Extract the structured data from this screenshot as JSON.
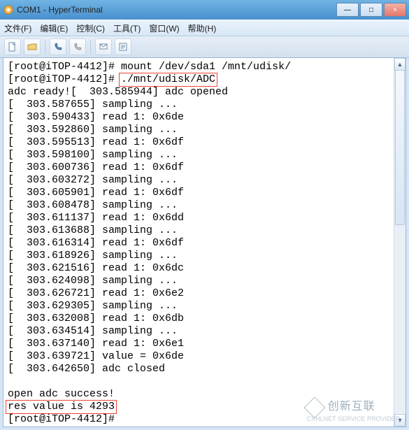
{
  "window": {
    "title": "COM1 - HyperTerminal",
    "buttons": {
      "min": "—",
      "max": "□",
      "close": "×"
    }
  },
  "menu": {
    "file": "文件(F)",
    "edit": "编辑(E)",
    "control": "控制(C)",
    "tools": "工具(T)",
    "window": "窗口(W)",
    "help": "帮助(H)"
  },
  "toolbar_icons": {
    "new": "new-doc-icon",
    "open": "open-folder-icon",
    "connect": "phone-connect-icon",
    "disconnect": "phone-disconnect-icon",
    "send": "send-icon",
    "properties": "properties-icon"
  },
  "terminal": {
    "line1_prompt": "[root@iTOP-4412]# ",
    "line1_cmd": "mount /dev/sda1 /mnt/udisk/",
    "line2_prompt": "[root@iTOP-4412]# ",
    "line2_cmd": "./mnt/udisk/ADC",
    "ready": "adc ready![  303.585944] adc opened",
    "log_rows": [
      "[  303.587655] sampling ...",
      "[  303.590433] read 1: 0x6de",
      "[  303.592860] sampling ...",
      "[  303.595513] read 1: 0x6df",
      "[  303.598100] sampling ...",
      "[  303.600736] read 1: 0x6df",
      "[  303.603272] sampling ...",
      "[  303.605901] read 1: 0x6df",
      "[  303.608478] sampling ...",
      "[  303.611137] read 1: 0x6dd",
      "[  303.613688] sampling ...",
      "[  303.616314] read 1: 0x6df",
      "[  303.618926] sampling ...",
      "[  303.621516] read 1: 0x6dc",
      "[  303.624098] sampling ...",
      "[  303.626721] read 1: 0x6e2",
      "[  303.629305] sampling ...",
      "[  303.632008] read 1: 0x6db",
      "[  303.634514] sampling ...",
      "[  303.637140] read 1: 0x6e1",
      "[  303.639721] value = 0x6de",
      "[  303.642650] adc closed"
    ],
    "blank": "",
    "success": "open adc success!",
    "res": "res value is 4293",
    "final_prompt": "[root@iTOP-4412]# "
  },
  "watermark": {
    "zh": "创新互联",
    "en": "CXHLNET SERVICE PROVIDER"
  }
}
